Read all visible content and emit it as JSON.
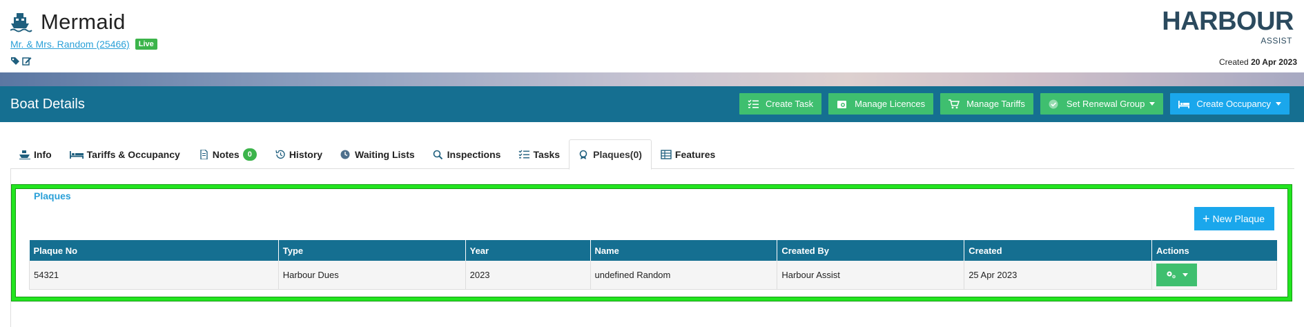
{
  "header": {
    "boat_name": "Mermaid",
    "owner_link": "Mr. & Mrs. Random (25466)",
    "status_badge": "Live",
    "logo_main": "HARBOUR",
    "logo_sub": "ASSIST",
    "created_label": "Created",
    "created_date": "20 Apr 2023"
  },
  "title_bar": {
    "title": "Boat Details",
    "buttons": {
      "create_task": "Create Task",
      "manage_licences": "Manage Licences",
      "manage_tariffs": "Manage Tariffs",
      "set_renewal_group": "Set Renewal Group",
      "create_occupancy": "Create Occupancy"
    }
  },
  "tabs": {
    "info": "Info",
    "tariffs": "Tariffs & Occupancy",
    "notes": "Notes",
    "notes_count": "0",
    "history": "History",
    "waiting_lists": "Waiting Lists",
    "inspections": "Inspections",
    "tasks": "Tasks",
    "plaques": "Plaques(0)",
    "features": "Features"
  },
  "plaques_panel": {
    "title": "Plaques",
    "new_button": "New Plaque",
    "columns": [
      "Plaque No",
      "Type",
      "Year",
      "Name",
      "Created By",
      "Created",
      "Actions"
    ],
    "rows": [
      {
        "plaque_no": "54321",
        "type": "Harbour Dues",
        "year": "2023",
        "name": "undefined Random",
        "created_by": "Harbour Assist",
        "created": "25 Apr 2023"
      }
    ]
  },
  "colors": {
    "primary_teal": "#156f91",
    "accent_green": "#3fbf6f",
    "accent_blue": "#1aa7ec",
    "highlight_border": "#22e51f",
    "link_blue": "#2aa0d8"
  }
}
